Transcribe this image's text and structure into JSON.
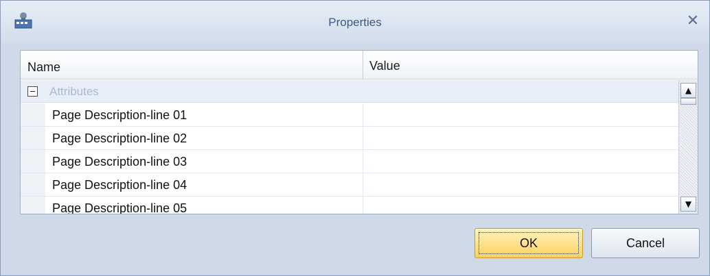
{
  "window": {
    "title": "Properties",
    "icon": "app-icon",
    "close_glyph": "✕"
  },
  "grid": {
    "columns": [
      "Name",
      "Value"
    ],
    "category": {
      "label": "Attributes",
      "expanded": true
    },
    "rows": [
      {
        "name": "Page Description-line 01",
        "value": ""
      },
      {
        "name": "Page Description-line 02",
        "value": ""
      },
      {
        "name": "Page Description-line 03",
        "value": ""
      },
      {
        "name": "Page Description-line 04",
        "value": ""
      },
      {
        "name": "Page Description-line 05",
        "value": ""
      }
    ]
  },
  "buttons": {
    "ok": "OK",
    "cancel": "Cancel"
  },
  "colors": {
    "title_text": "#3b5a86",
    "ok_button": "#fcd15f",
    "category_bg": "#e7eef8"
  }
}
